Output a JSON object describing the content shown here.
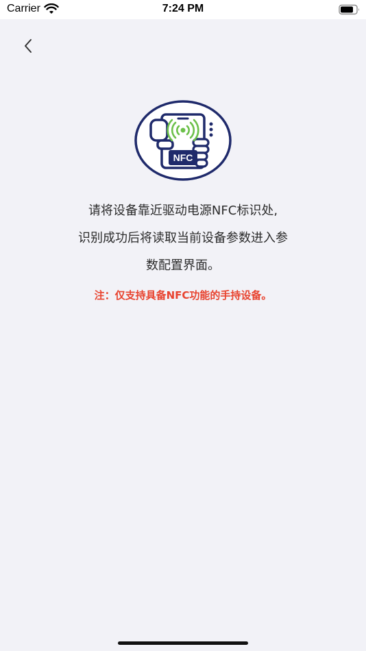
{
  "status_bar": {
    "carrier": "Carrier",
    "time": "7:24 PM",
    "wifi_icon": "wifi-icon",
    "battery_icon": "battery-icon"
  },
  "nav": {
    "back_icon": "chevron-left-icon"
  },
  "illustration": {
    "icon": "nfc-phone-icon",
    "label": "NFC",
    "colors": {
      "outline": "#1f2a6b",
      "signal": "#6cc04a"
    }
  },
  "instructions": {
    "line1": "请将设备靠近驱动电源NFC标识处,",
    "line2": "识别成功后将读取当前设备参数进入参",
    "line3": "数配置界面。"
  },
  "note": {
    "text": "注：仅支持具备NFC功能的手持设备。",
    "color": "#e8432f"
  }
}
